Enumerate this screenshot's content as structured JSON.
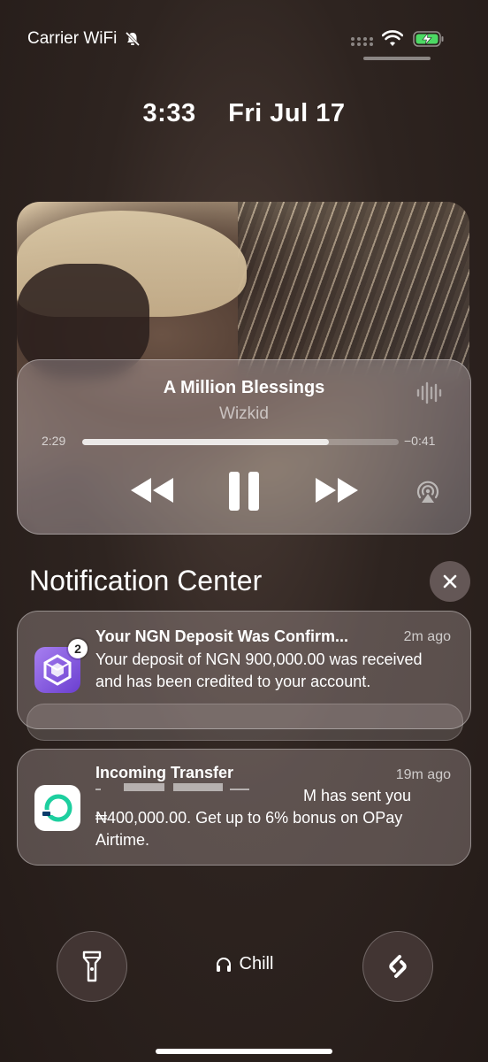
{
  "status_bar": {
    "carrier": "Carrier WiFi",
    "icons": [
      "bell-slash-icon",
      "signal-dots-icon",
      "wifi-icon",
      "battery-charging-icon"
    ]
  },
  "lock_screen": {
    "time": "3:33",
    "date": "Fri Jul 17"
  },
  "now_playing": {
    "title": "A Million Blessings",
    "artist": "Wizkid",
    "elapsed": "2:29",
    "remaining": "−0:41",
    "progress": 0.78,
    "controls": [
      "rewind-icon",
      "pause-icon",
      "fast-forward-icon",
      "airplay-icon"
    ]
  },
  "notification_center": {
    "title": "Notification Center",
    "clear_icon": "close-icon",
    "notifications": [
      {
        "title": "Your NGN Deposit Was Confirm...",
        "time": "2m ago",
        "body": "Your deposit of NGN 900,000.00 was received and has been credited to your account.",
        "badge": "2",
        "icon": "crypto-exchange-app-icon",
        "accent": "#7b4fd6"
      },
      {
        "title": "Incoming Transfer",
        "time": "19m ago",
        "body_line1_tail": "М has sent you",
        "body_rest": "₦400,000.00.  Get up to 6% bonus on OPay Airtime.",
        "icon": "opay-app-icon",
        "accent": "#1dcf9f"
      }
    ]
  },
  "bottom_bar": {
    "focus_label": "Chill",
    "focus_icon": "headphones-icon",
    "left_button_icon": "flashlight-icon",
    "right_button_icon": "shazam-icon"
  }
}
